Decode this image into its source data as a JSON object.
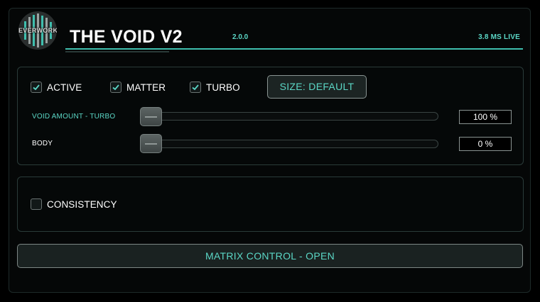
{
  "header": {
    "brand": "EVERWORKS",
    "title": "THE VOID V2",
    "version": "2.0.0",
    "latency": "3.8 MS LIVE"
  },
  "toggles": [
    {
      "label": "ACTIVE",
      "checked": true
    },
    {
      "label": "MATTER",
      "checked": true
    },
    {
      "label": "TURBO",
      "checked": true
    }
  ],
  "size_button": "SIZE: DEFAULT",
  "params": [
    {
      "label": "VOID AMOUNT - TURBO",
      "value": "100 %",
      "label_color": "#5bd7c6"
    },
    {
      "label": "BODY",
      "value": "0 %",
      "label_color": "#ffffff"
    }
  ],
  "consistency": {
    "label": "CONSISTENCY",
    "checked": false
  },
  "matrix_button": "MATRIX CONTROL - OPEN",
  "colors": {
    "accent": "#5bd7c6",
    "background": "#000000"
  },
  "icons": {
    "checkbox_checked": "check-icon",
    "slider_handle": "slider-knob-icon"
  }
}
